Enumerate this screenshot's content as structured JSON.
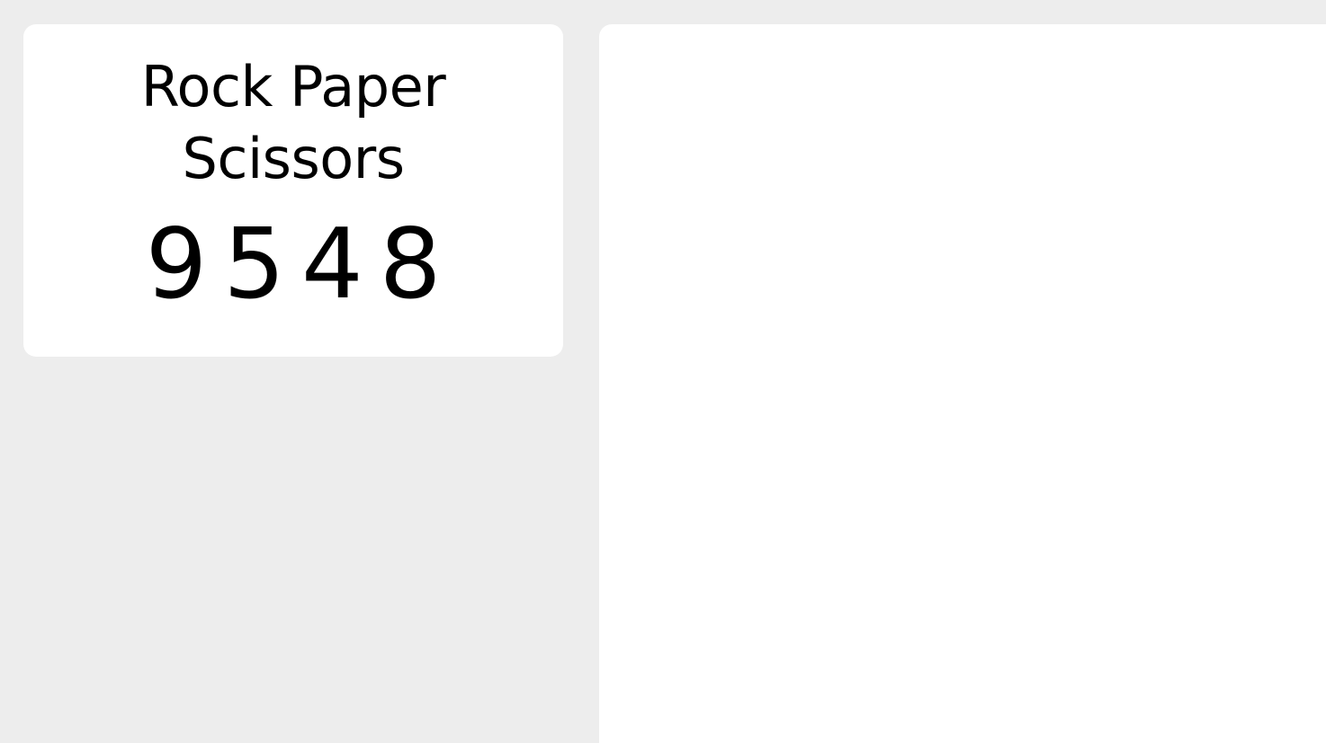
{
  "scoreboard": {
    "title_line1": "Rock Paper",
    "title_line2": "Scissors",
    "score": "9548"
  },
  "colors": {
    "background": "#ededed",
    "card": "#ffffff",
    "text": "#000000"
  }
}
